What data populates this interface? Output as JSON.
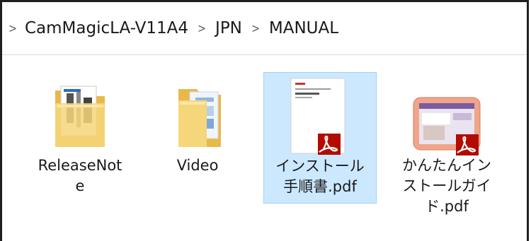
{
  "breadcrumb": {
    "items": [
      "CamMagicLA-V11A4",
      "JPN",
      "MANUAL"
    ]
  },
  "files": [
    {
      "name_lines": [
        "ReleaseNot",
        "e"
      ],
      "type": "folder-docs",
      "selected": false
    },
    {
      "name_lines": [
        "Video"
      ],
      "type": "folder",
      "selected": false
    },
    {
      "name_lines": [
        "インストール",
        "手順書.pdf"
      ],
      "type": "pdf",
      "selected": true
    },
    {
      "name_lines": [
        "かんたんイン",
        "ストールガイ",
        "ド.pdf"
      ],
      "type": "pdf-guide",
      "selected": false
    }
  ],
  "colors": {
    "selection_bg": "#cce8ff",
    "selection_border": "#99d1ff",
    "folder": "#f6d67a",
    "pdf_badge": "#b30b00"
  }
}
